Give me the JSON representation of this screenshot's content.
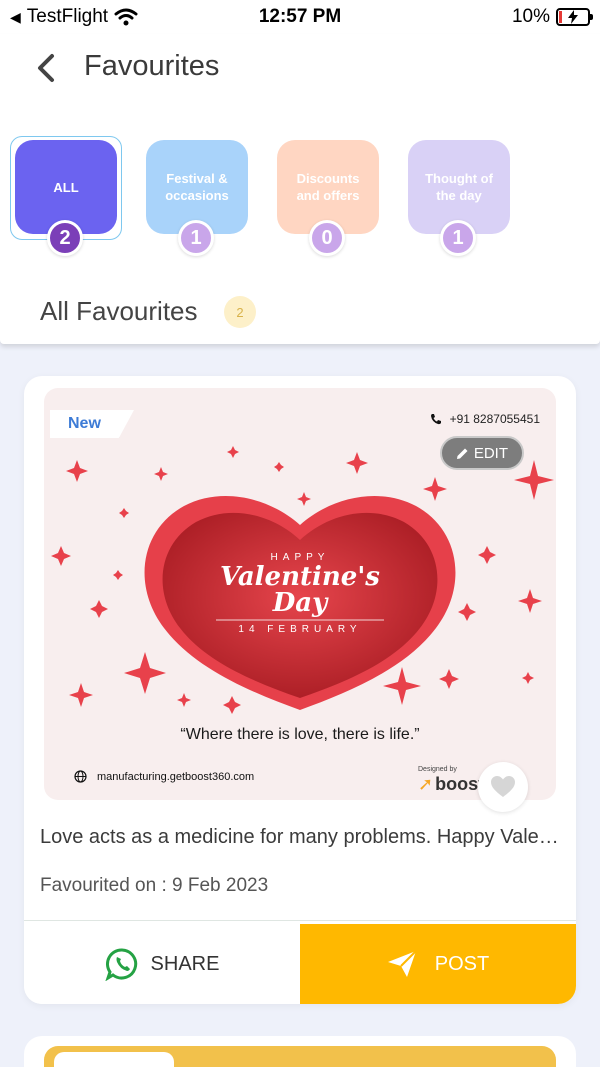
{
  "status_bar": {
    "back_app": "TestFlight",
    "time": "12:57 PM",
    "battery": "10%",
    "battery_level": 0.1
  },
  "header": {
    "title": "Favourites"
  },
  "categories": [
    {
      "label": "ALL",
      "count": "2",
      "color": "#6b63f0",
      "badge_color": "#7b3fb8"
    },
    {
      "label": "Festival & occasions",
      "count": "1",
      "color": "#a9d3fa",
      "badge_color": "#c9a6ea"
    },
    {
      "label": "Discounts and offers",
      "count": "0",
      "color": "#ffd6c2",
      "badge_color": "#c9a6ea"
    },
    {
      "label": "Thought of the day",
      "count": "1",
      "color": "#d9d1f6",
      "badge_color": "#c9a6ea"
    }
  ],
  "section": {
    "title": "All Favourites",
    "count": "2"
  },
  "post": {
    "tag": "New",
    "phone": "+91 8287055451",
    "edit_label": "EDIT",
    "poster_small_top": "HAPPY",
    "poster_title_1": "Valentine's",
    "poster_title_2": "Day",
    "poster_date": "14 FEBRUARY",
    "quote": "“Where there is love, there is life.”",
    "website": "manufacturing.getboost360.com",
    "designed_by": "Designed by",
    "brand": "boost",
    "caption": "Love acts as a medicine for many problems. Happy Valentine's Day",
    "favourited_on": "Favourited on : 9 Feb 2023",
    "share_label": "SHARE",
    "post_label": "POST"
  },
  "colors": {
    "accent": "#ffb800",
    "heart": "#c8232f",
    "whatsapp": "#25a244"
  }
}
